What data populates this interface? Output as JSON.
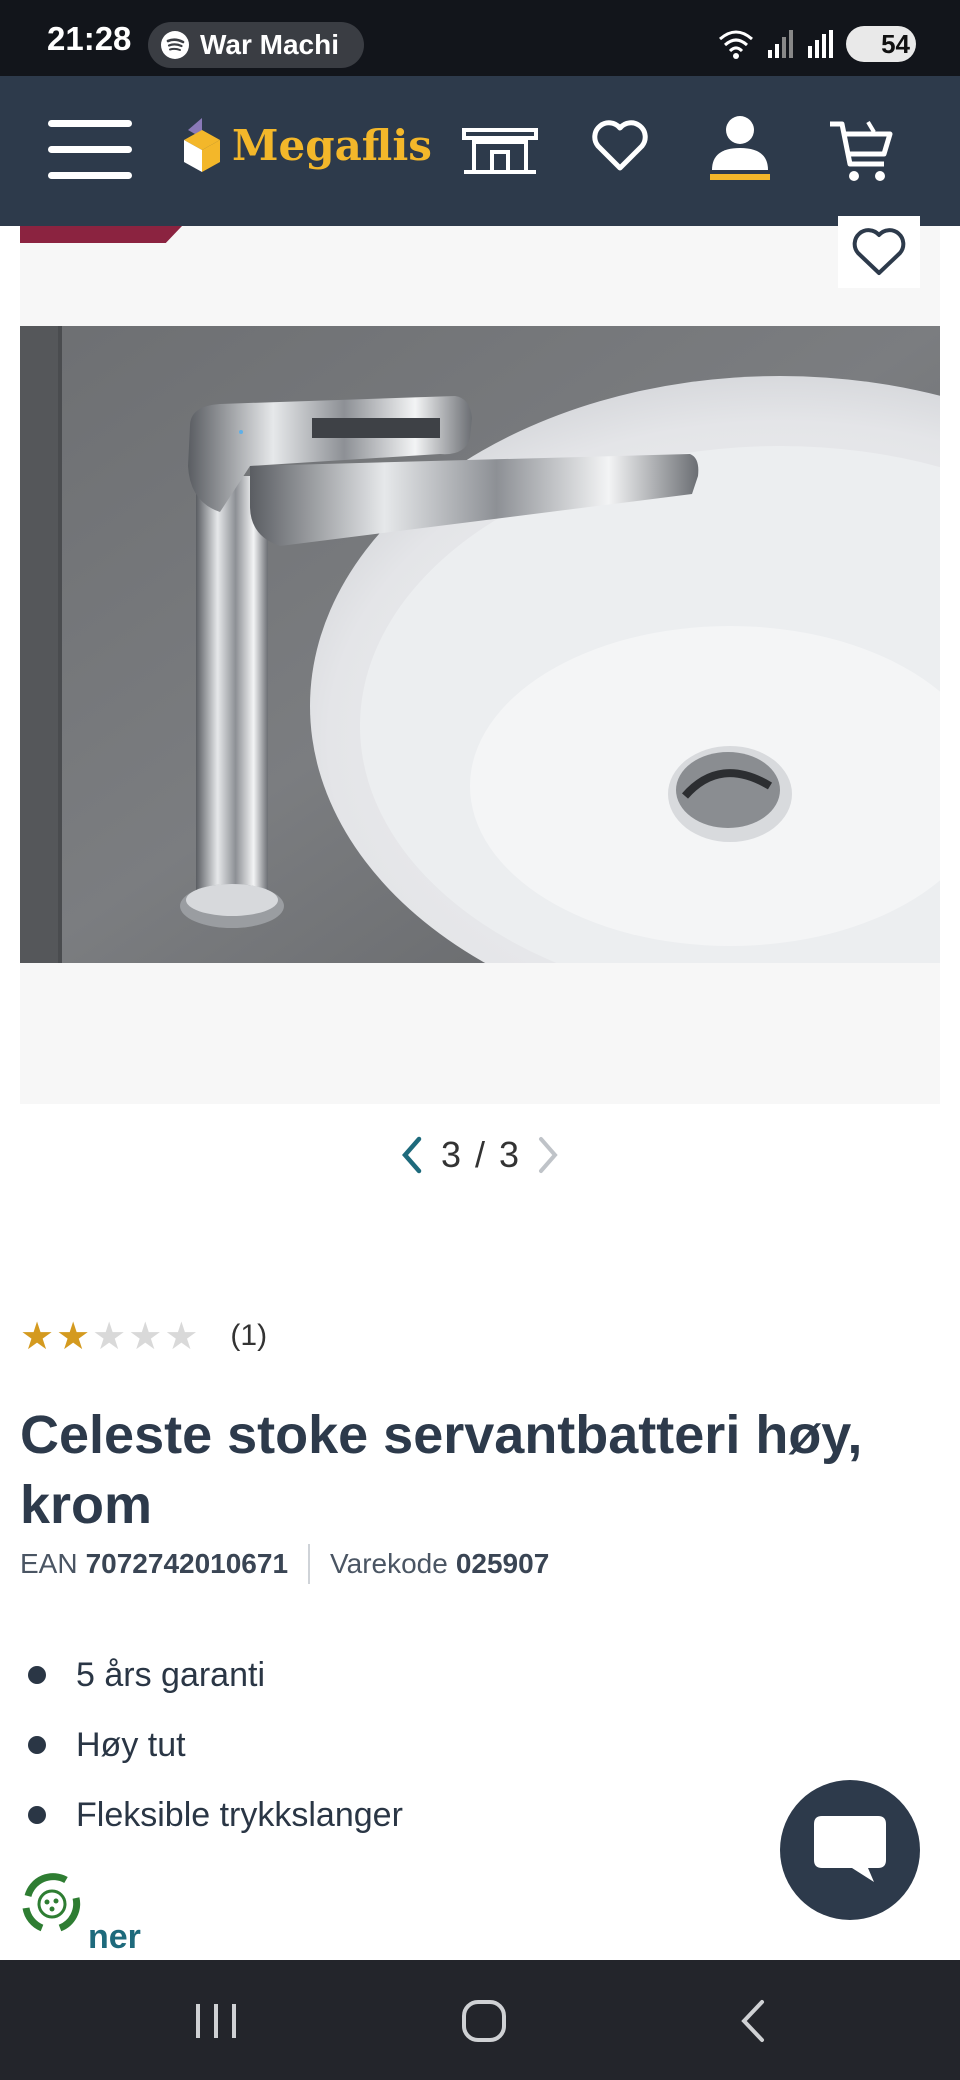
{
  "status_bar": {
    "time": "21:28",
    "media_text": "War Machi",
    "battery": "54"
  },
  "header": {
    "brand": "Megaflis"
  },
  "gallery": {
    "current": "3",
    "separator": "/",
    "total": "3"
  },
  "product": {
    "rating": 2,
    "rating_max": 5,
    "review_count": "(1)",
    "title": "Celeste stoke servantbatteri høy, krom",
    "ean_label": "EAN",
    "ean_value": "7072742010671",
    "code_label": "Varekode",
    "code_value": "025907",
    "features": [
      "5 års garanti",
      "Høy tut",
      "Fleksible trykkslanger"
    ],
    "more_link": "ner"
  },
  "colors": {
    "header_bg": "#2d3a4b",
    "brand_yellow": "#f3b72a",
    "star_filled": "#d49a1f",
    "star_empty": "#d9d9d9",
    "link": "#1e6a7c",
    "badge": "#8b2340"
  }
}
